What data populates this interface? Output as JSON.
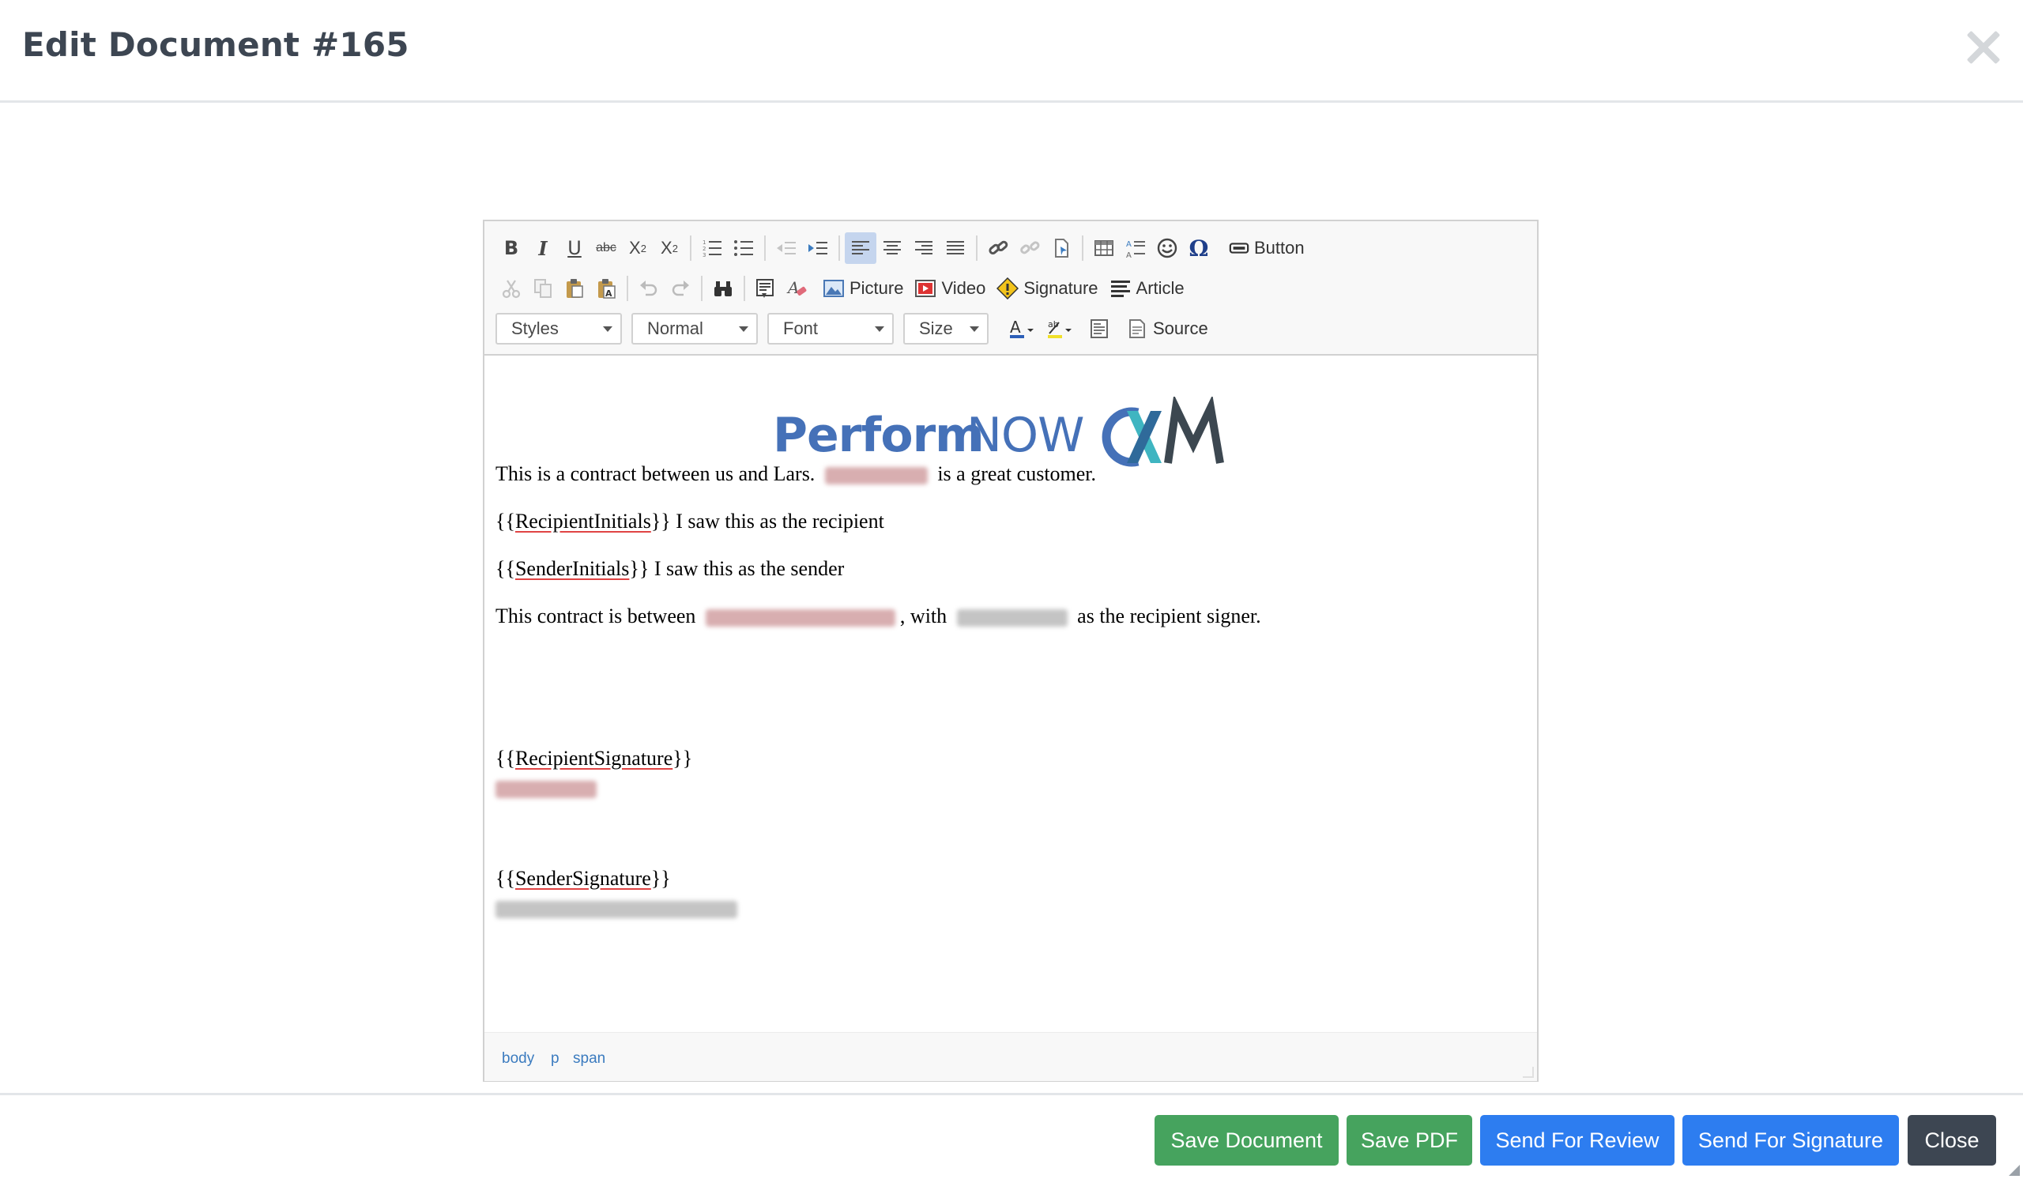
{
  "header": {
    "title": "Edit Document #165"
  },
  "toolbar": {
    "button_label": "Button",
    "picture_label": "Picture",
    "video_label": "Video",
    "signature_label": "Signature",
    "article_label": "Article",
    "source_label": "Source",
    "styles": "Styles",
    "format": "Normal",
    "font": "Font",
    "size": "Size"
  },
  "logo": {
    "perform": "Perform",
    "now": "NOW",
    "cxm": "CXM"
  },
  "content": {
    "line1_a": "This is a contract between us and Lars.",
    "line1_b": "is a great customer.",
    "line2_open": "{{",
    "line2_field": "RecipientInitials",
    "line2_close": "}} I saw this as the recipient",
    "line3_open": "{{",
    "line3_field": "SenderInitials",
    "line3_close": "}} I saw this as the sender",
    "line4_a": "This contract is between",
    "line4_b": ", with",
    "line4_c": "as the recipient signer.",
    "sig1_open": "{{",
    "sig1_field": "RecipientSignature",
    "sig1_close": "}}",
    "sig2_open": "{{",
    "sig2_field": "SenderSignature",
    "sig2_close": "}}"
  },
  "statusbar": {
    "path": [
      "body",
      "p",
      "span"
    ]
  },
  "footer": {
    "save_document": "Save Document",
    "save_pdf": "Save PDF",
    "send_review": "Send For Review",
    "send_signature": "Send For Signature",
    "close": "Close"
  },
  "colors": {
    "save_green": "#46a35e",
    "send_blue": "#2d7df0",
    "close_dark": "#3d4652",
    "logo_blue": "#4571b8",
    "logo_teal": "#3fb5c1",
    "logo_dark": "#3c4750"
  }
}
